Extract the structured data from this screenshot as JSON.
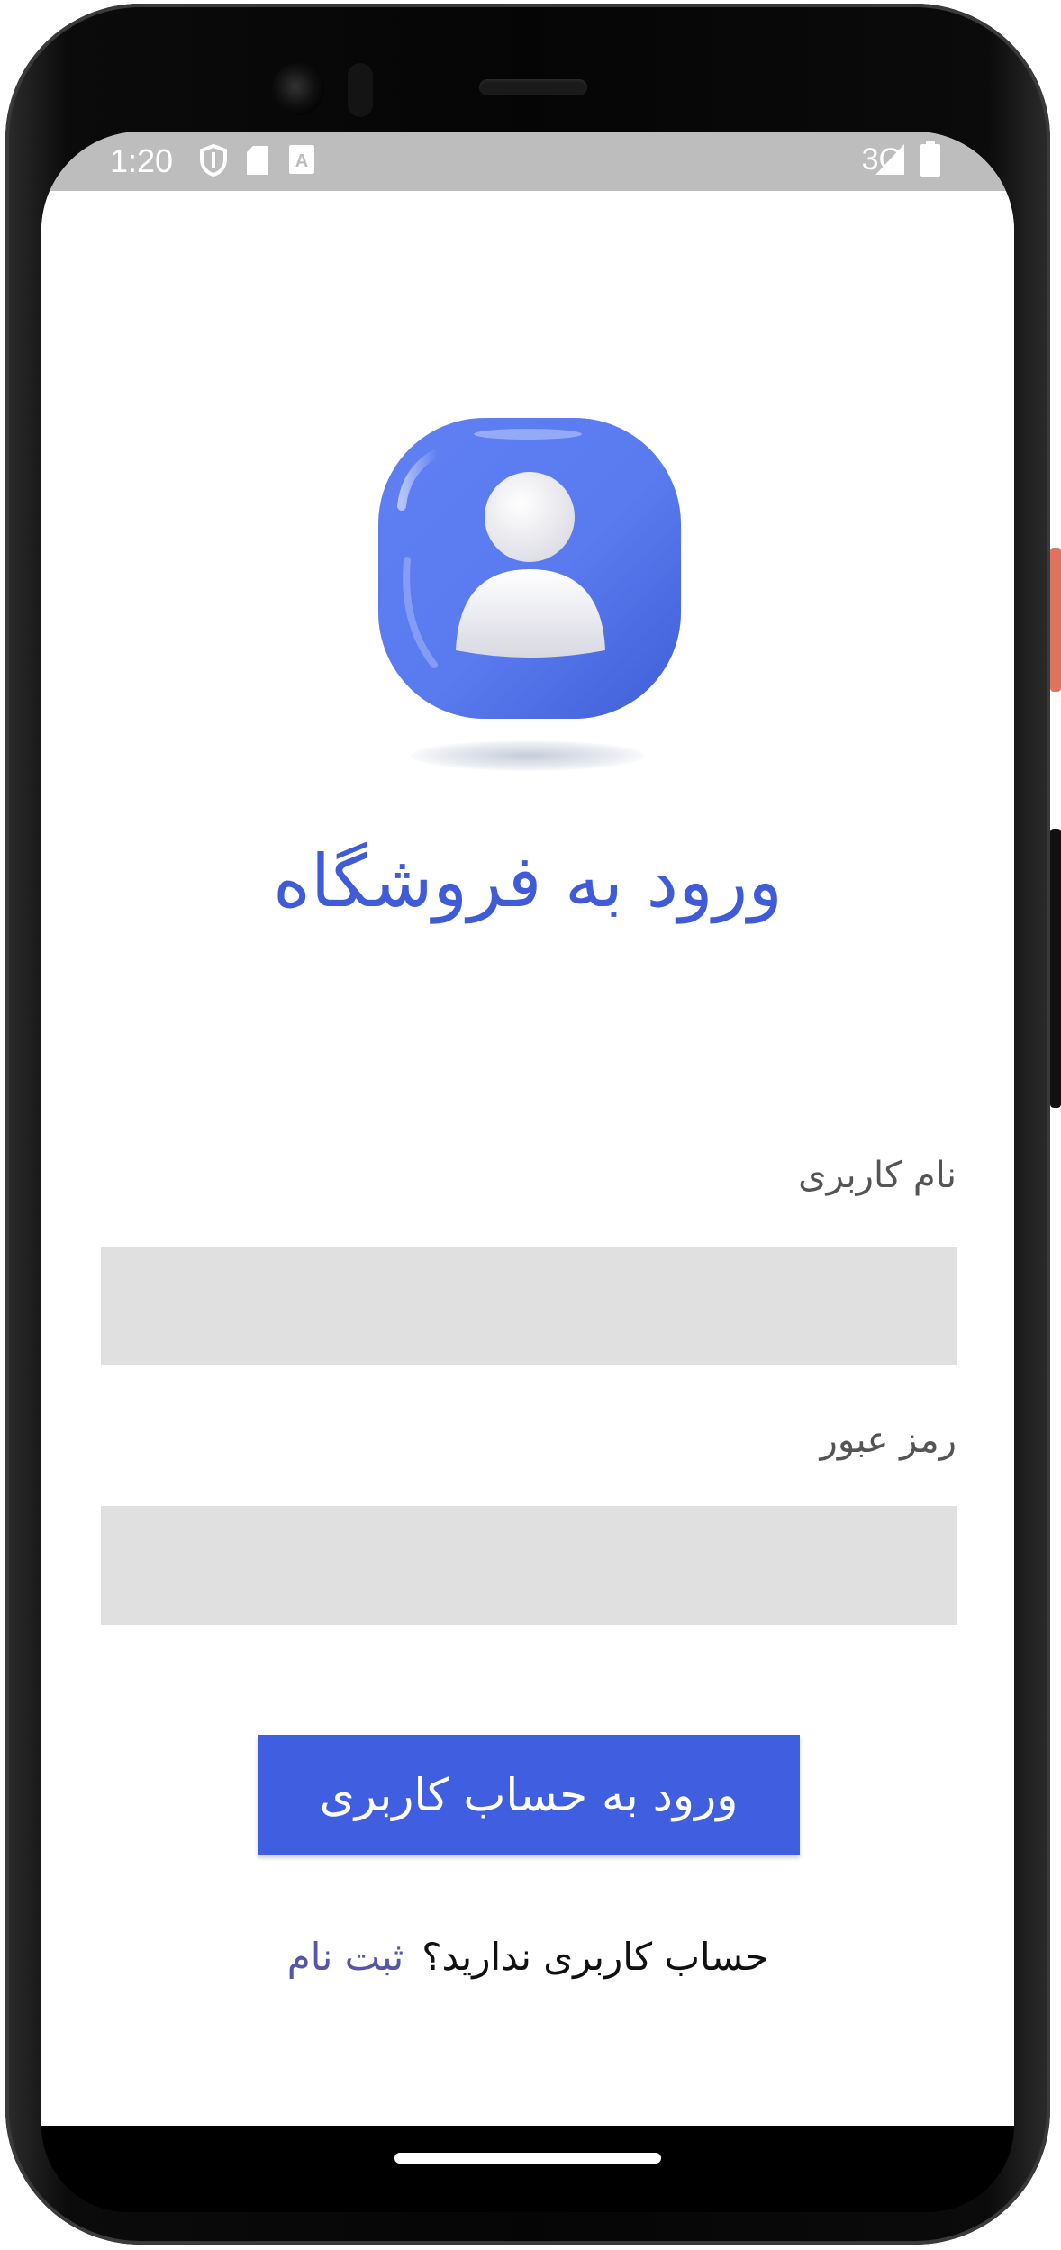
{
  "status_bar": {
    "time": "1:20",
    "network": "3G",
    "icons": [
      "shield-icon",
      "sd-card-icon",
      "keyboard-a-icon",
      "signal-icon",
      "battery-icon"
    ]
  },
  "app_icon": "user-profile-icon",
  "login": {
    "title": "ورود به فروشگاه",
    "username_label": "نام کاربری",
    "username_value": "",
    "password_label": "رمز عبور",
    "password_value": "",
    "submit_label": "ورود به حساب کاربری",
    "no_account_text": "حساب کاربری ندارید؟",
    "signup_link": "ثبت نام"
  },
  "colors": {
    "accent": "#3f5ee0",
    "title": "#3f5bd8",
    "field_background": "#e0e0e0",
    "status_bar": "#bdbdbd",
    "link": "#5555aa"
  }
}
